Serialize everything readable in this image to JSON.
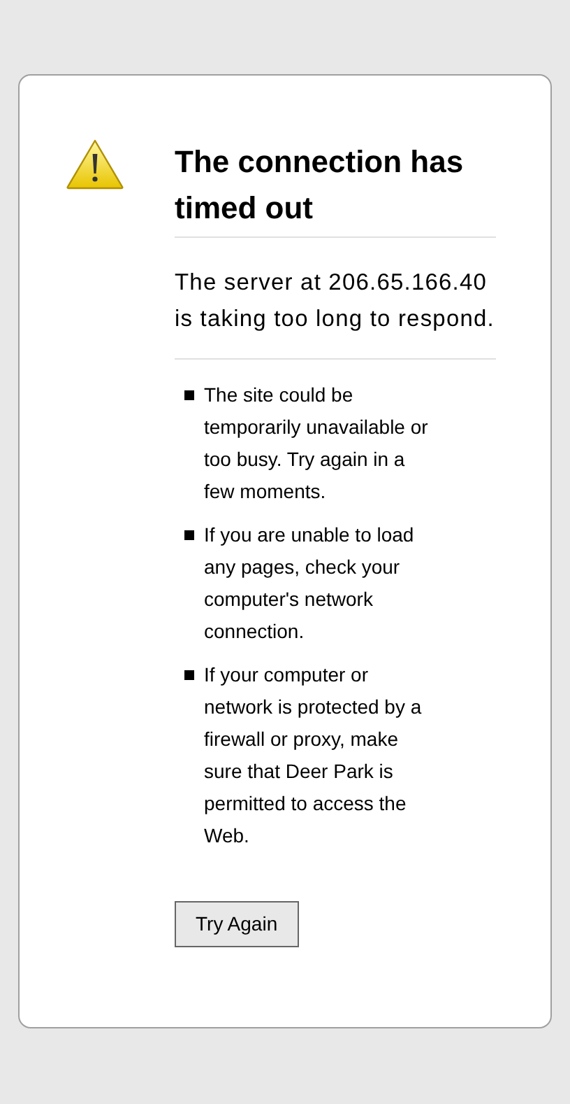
{
  "title": "The connection has timed out",
  "description": "The server at 206.65.166.40 is taking too long to respond.",
  "suggestions": [
    "The site could be temporarily unavailable or too busy. Try again in a few moments.",
    "If you are unable to load any pages, check your computer's network connection.",
    "If your computer or network is protected by a firewall or proxy, make sure that Deer Park is permitted to access the Web."
  ],
  "button": {
    "label": "Try Again"
  }
}
